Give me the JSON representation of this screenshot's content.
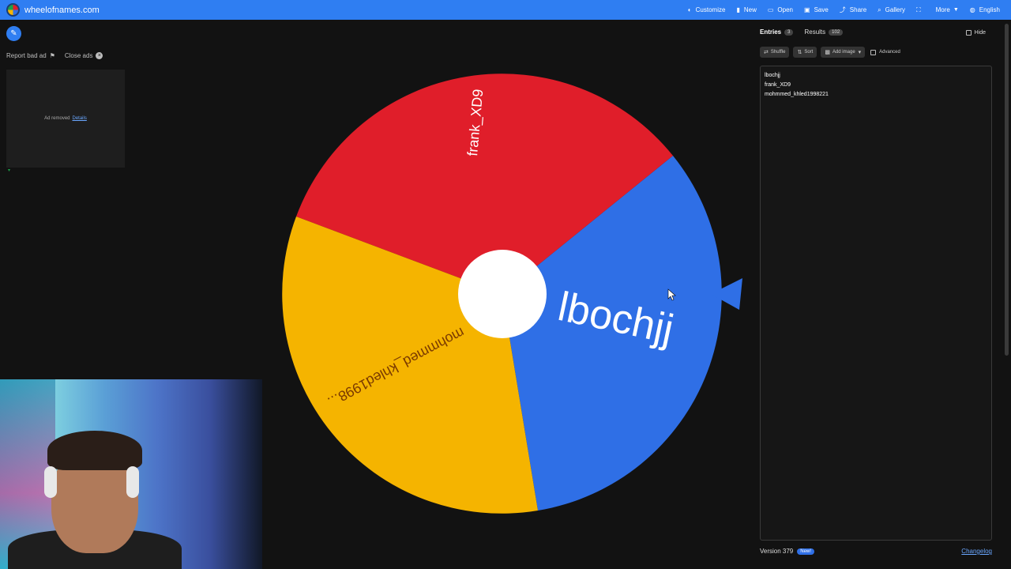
{
  "app": {
    "site_name": "wheelofnames.com",
    "menu": [
      {
        "label": "Customize",
        "icon": "palette-icon",
        "glyph": "◐"
      },
      {
        "label": "New",
        "icon": "file-icon",
        "glyph": "▮"
      },
      {
        "label": "Open",
        "icon": "folder-icon",
        "glyph": "▭"
      },
      {
        "label": "Save",
        "icon": "save-icon",
        "glyph": "▣"
      },
      {
        "label": "Share",
        "icon": "share-icon",
        "glyph": "⤴"
      },
      {
        "label": "Gallery",
        "icon": "search-icon",
        "glyph": "⌕"
      },
      {
        "label": "",
        "icon": "fullscreen-icon",
        "glyph": "⛶"
      },
      {
        "label": "More",
        "icon": "",
        "glyph": ""
      },
      {
        "label": "English",
        "icon": "globe-icon",
        "glyph": "◍"
      }
    ],
    "accent_color": "#2f7ef2"
  },
  "ads": {
    "report_label": "Report bad ad",
    "close_label": "Close ads",
    "removed_text": "Ad removed",
    "details_link": "Details"
  },
  "wheel": {
    "segments": [
      {
        "label": "lbochjj",
        "color": "#2f6fe6"
      },
      {
        "label": "frank_XD9",
        "color": "#e01e2a"
      },
      {
        "label": "mohmmed_khled1998...",
        "color": "#f5b400"
      }
    ],
    "hub_color": "#ffffff",
    "pointer_color": "#2f6fe6"
  },
  "panel": {
    "tabs": [
      {
        "label": "Entries",
        "count": "3"
      },
      {
        "label": "Results",
        "count": "102"
      }
    ],
    "hide_label": "Hide",
    "toolbar": {
      "shuffle": "Shuffle",
      "sort": "Sort",
      "add_image": "Add image",
      "advanced": "Advanced"
    },
    "entries": [
      "lbochjj",
      "frank_XD9",
      "mohmmed_khled1998221"
    ],
    "version": "Version 379",
    "new_badge": "New!",
    "changelog": "Changelog"
  }
}
